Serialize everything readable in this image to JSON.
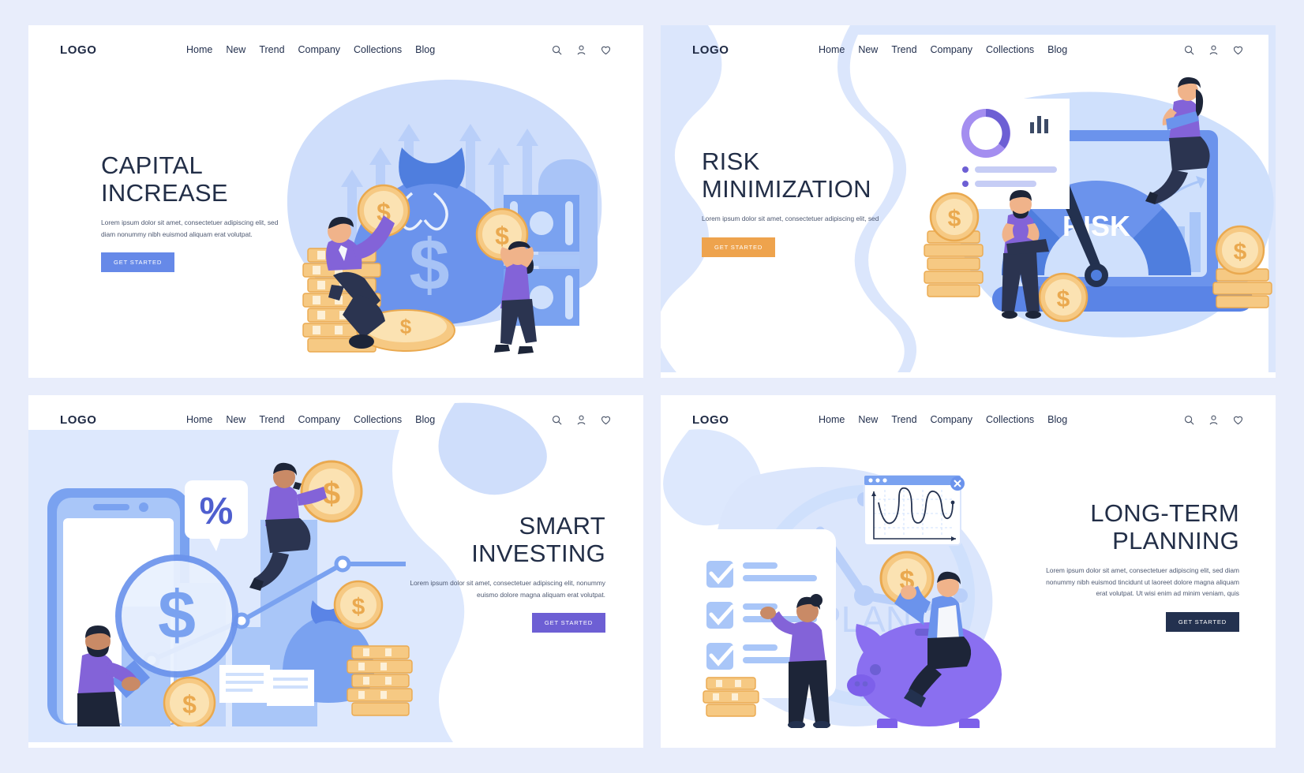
{
  "page": {
    "background": "#e8edfb",
    "panel_count": 4
  },
  "nav": {
    "logo": "LOGO",
    "items": [
      {
        "label": "Home"
      },
      {
        "label": "New"
      },
      {
        "label": "Trend"
      },
      {
        "label": "Company"
      },
      {
        "label": "Collections"
      },
      {
        "label": "Blog"
      }
    ],
    "icons": [
      "search-icon",
      "user-icon",
      "heart-icon"
    ]
  },
  "panels": [
    {
      "id": "capital-increase",
      "title_line1": "CAPITAL",
      "title_line2": "INCREASE",
      "body": "Lorem ipsum dolor sit amet, consectetuer adipiscing elit, sed diam nonummy nibh euismod aliquam erat volutpat.",
      "cta": "GET STARTED",
      "cta_color": "#6689e8",
      "accent": "#6689e8",
      "align": "left",
      "illustration": "coins-moneybag-growth-arrows"
    },
    {
      "id": "risk-minimization",
      "title_line1": "RISK",
      "title_line2": "MINIMIZATION",
      "body": "Lorem ipsum dolor sit amet, consectetuer adipiscing elit, sed",
      "cta": "GET STARTED",
      "cta_color": "#eea34d",
      "accent": "#eea34d",
      "align": "left",
      "gauge_label": "RISK",
      "illustration": "risk-gauge-dashboard-coins"
    },
    {
      "id": "smart-investing",
      "title_line1": "SMART",
      "title_line2": "INVESTING",
      "body": "Lorem ipsum dolor sit amet, consectetuer adipiscing elit, nonummy euismo dolore magna aliquam erat volutpat.",
      "cta": "GET STARTED",
      "cta_color": "#6d5fd4",
      "accent": "#6d5fd4",
      "align": "right",
      "bubble_label": "%",
      "illustration": "phone-chart-magnifier-moneybag"
    },
    {
      "id": "long-term-planning",
      "title_line1": "LONG-TERM",
      "title_line2": "PLANNING",
      "body": "Lorem ipsum dolor sit amet, consectetuer adipiscing elit, sed diam nonummy nibh euismod tincidunt ut laoreet dolore magna aliquam erat volutpat. Ut wisi enim ad minim veniam, quis",
      "cta": "GET STARTED",
      "cta_color": "#23314f",
      "accent": "#8a6ff0",
      "align": "right",
      "clock_label": "PLAN",
      "illustration": "checklist-clock-piggybank-chart"
    }
  ]
}
